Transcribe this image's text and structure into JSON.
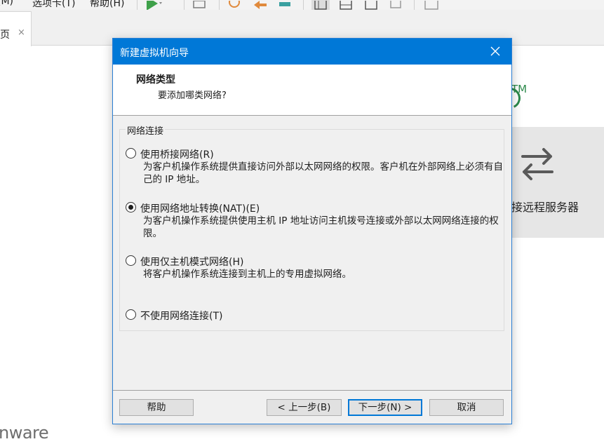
{
  "menubar": {
    "items": [
      "(M)",
      "选项卡(T)",
      "帮助(H)"
    ]
  },
  "tabs": {
    "home": {
      "label": "页",
      "close": "×"
    }
  },
  "background": {
    "trademark": "TM",
    "remote_card_label": "接远程服务器",
    "vmware_logo": "nware"
  },
  "dialog": {
    "title": "新建虚拟机向导",
    "close_glyph": "✕",
    "header": {
      "title": "网络类型",
      "subtitle": "要添加哪类网络?"
    },
    "group_title": "网络连接",
    "options": [
      {
        "label": "使用桥接网络(R)",
        "desc": "为客户机操作系统提供直接访问外部以太网网络的权限。客户机在外部网络上必须有自己的 IP 地址。",
        "checked": false
      },
      {
        "label": "使用网络地址转换(NAT)(E)",
        "desc": "为客户机操作系统提供使用主机 IP 地址访问主机拨号连接或外部以太网网络连接的权限。",
        "checked": true
      },
      {
        "label": "使用仅主机模式网络(H)",
        "desc": "将客户机操作系统连接到主机上的专用虚拟网络。",
        "checked": false
      },
      {
        "label": "不使用网络连接(T)",
        "desc": "",
        "checked": false
      }
    ],
    "buttons": {
      "help": "帮助",
      "back": "< 上一步(B)",
      "next": "下一步(N) >",
      "cancel": "取消"
    }
  },
  "colors": {
    "titlebar": "#0078d7",
    "brand_green": "#2c8a4b"
  }
}
